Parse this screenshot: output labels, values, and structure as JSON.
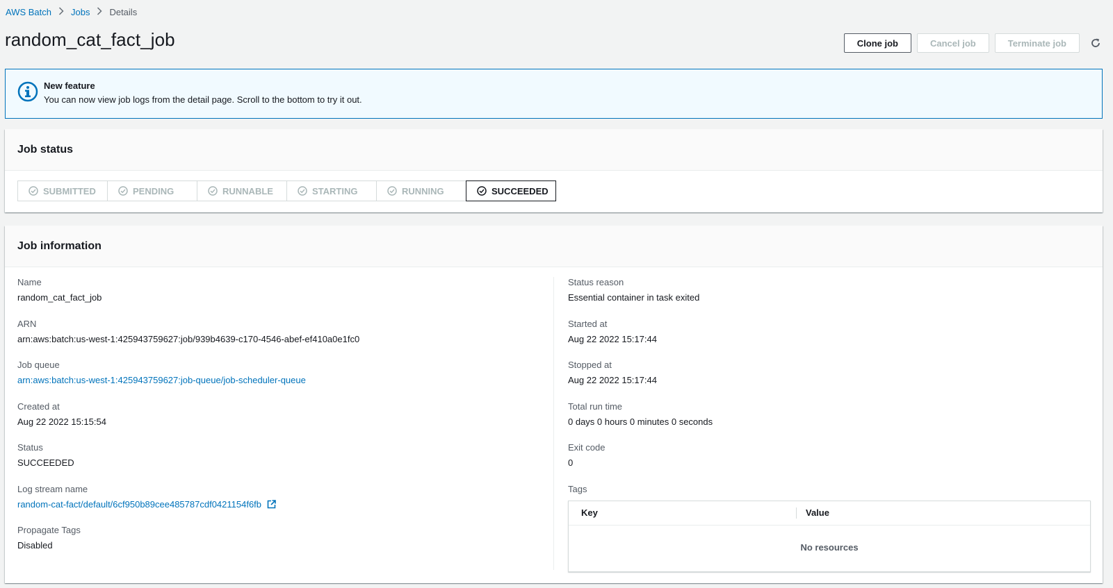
{
  "breadcrumb": {
    "items": [
      "AWS Batch",
      "Jobs"
    ],
    "current": "Details"
  },
  "page_title": "random_cat_fact_job",
  "actions": {
    "clone": "Clone job",
    "cancel": "Cancel job",
    "terminate": "Terminate job"
  },
  "flash": {
    "title": "New feature",
    "message": "You can now view job logs from the detail page. Scroll to the bottom to try it out."
  },
  "job_status": {
    "title": "Job status",
    "steps": [
      "SUBMITTED",
      "PENDING",
      "RUNNABLE",
      "STARTING",
      "RUNNING",
      "SUCCEEDED"
    ],
    "active": "SUCCEEDED"
  },
  "job_info": {
    "title": "Job information",
    "left": [
      {
        "label": "Name",
        "value": "random_cat_fact_job"
      },
      {
        "label": "ARN",
        "value": "arn:aws:batch:us-west-1:425943759627:job/939b4639-c170-4546-abef-ef410a0e1fc0"
      },
      {
        "label": "Job queue",
        "value": "arn:aws:batch:us-west-1:425943759627:job-queue/job-scheduler-queue"
      },
      {
        "label": "Created at",
        "value": "Aug 22 2022 15:15:54"
      },
      {
        "label": "Status",
        "value": "SUCCEEDED"
      },
      {
        "label": "Log stream name",
        "value": "random-cat-fact/default/6cf950b89cee485787cdf0421154f6fb"
      },
      {
        "label": "Propagate Tags",
        "value": "Disabled"
      }
    ],
    "right": [
      {
        "label": "Status reason",
        "value": "Essential container in task exited"
      },
      {
        "label": "Started at",
        "value": "Aug 22 2022 15:17:44"
      },
      {
        "label": "Stopped at",
        "value": "Aug 22 2022 15:17:44"
      },
      {
        "label": "Total run time",
        "value": "0 days 0 hours 0 minutes 0 seconds"
      },
      {
        "label": "Exit code",
        "value": "0"
      }
    ],
    "tags": {
      "label": "Tags",
      "columns": [
        "Key",
        "Value"
      ],
      "empty": "No resources"
    }
  },
  "colors": {
    "link": "#0073bb",
    "flash_bg": "#f1faff",
    "flash_border": "#0073bb",
    "disabled": "#aab7b8"
  },
  "icons": {
    "flash": "info-circle-icon",
    "refresh": "refresh-icon",
    "step": "check-circle-icon",
    "external": "external-link-icon"
  }
}
